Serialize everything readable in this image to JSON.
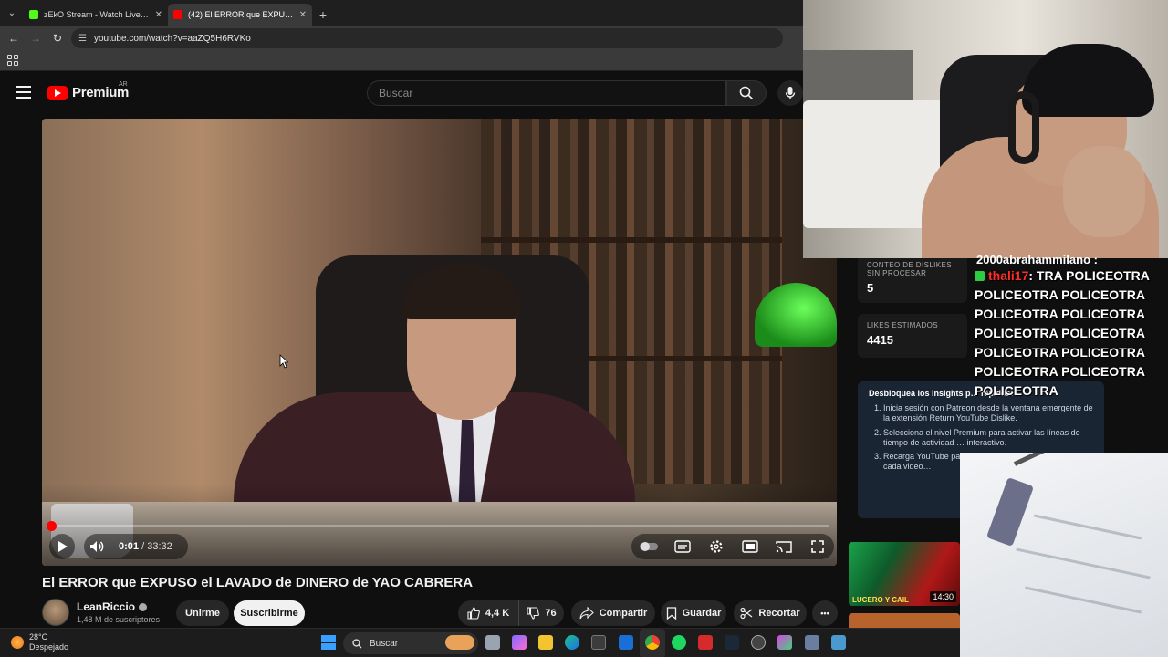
{
  "browser": {
    "tabs": [
      {
        "title": "zEkO Stream - Watch Live on K",
        "favicon_color": "#53fc18",
        "active": false
      },
      {
        "title": "(42) El ERROR que EXPUSO el L",
        "favicon_color": "#ff0000",
        "active": true
      }
    ],
    "new_tab": "+",
    "url": "youtube.com/watch?v=aaZQ5H6RVKo"
  },
  "youtube": {
    "logo_text": "Premium",
    "country_code": "AR",
    "search_placeholder": "Buscar",
    "player": {
      "current_time": "0:01",
      "separator": " / ",
      "duration": "33:32",
      "progress_fraction": 0.0005
    },
    "video_title": "El ERROR que EXPUSO el LAVADO de DINERO de YAO CABRERA",
    "channel": {
      "name": "LeanRiccio",
      "subscribers": "1,48 M de suscriptores",
      "join_label": "Unirme",
      "subscribe_label": "Suscribirme"
    },
    "actions": {
      "likes": "4,4 K",
      "dislikes": "76",
      "share": "Compartir",
      "save": "Guardar",
      "clip": "Recortar",
      "more": "•••"
    },
    "sidebar": {
      "dislike_count_label": "CONTEO DE DISLIKES SIN PROCESAR",
      "dislike_count_value": "5",
      "likes_est_label": "LIKES ESTIMADOS",
      "likes_est_value": "4415",
      "info_title": "Desbloquea los insights p… rápidos:",
      "info_steps": [
        "Inicia sesión con Patreon desde la ventana emergente de la extensión Return YouTube Dislike.",
        "Selecciona el nivel Premium para activar las líneas de tiempo de actividad … interactivo.",
        "Recarga YouTube pa… países principales y… UU. para cada video…"
      ],
      "thumb_duration": "14:30",
      "thumb_caption": "LUCERO Y CAIL"
    }
  },
  "overlay_chat": {
    "prev_line": "2000abrahammilano :",
    "user": "thali17",
    "message": ": TRA POLICEOTRA POLICEOTRA POLICEOTRA POLICEOTRA POLICEOTRA POLICEOTRA POLICEOTRA POLICEOTRA POLICEOTRA POLICEOTRA POLICEOTRA POLICEOTRA"
  },
  "taskbar": {
    "weather_temp": "28°C",
    "weather_desc": "Despejado",
    "search_label": "Buscar"
  }
}
